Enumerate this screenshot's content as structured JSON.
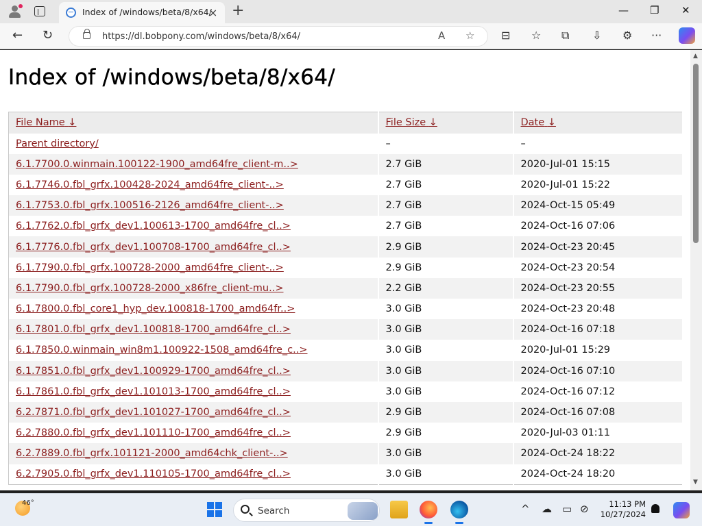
{
  "browser": {
    "tab": {
      "title": "Index of /windows/beta/8/x64/",
      "close_icon": "×"
    },
    "new_tab_icon": "+",
    "window_controls": {
      "minimize": "—",
      "maximize": "❐",
      "close": "✕"
    },
    "nav": {
      "back": "←",
      "refresh": "↻"
    },
    "address": {
      "url": "https://dl.bobpony.com/windows/beta/8/x64/",
      "read_aloud": "A",
      "favorite": "☆"
    },
    "toolbar_icons": {
      "split": "⊟",
      "favorites": "☆",
      "collections": "⧉",
      "downloads": "⇩",
      "extensions": "⚙",
      "more": "···"
    }
  },
  "page": {
    "title": "Index of /windows/beta/8/x64/",
    "columns": [
      {
        "label": "File Name",
        "sort": "↓"
      },
      {
        "label": "File Size",
        "sort": "↓"
      },
      {
        "label": "Date",
        "sort": "↓"
      }
    ],
    "rows": [
      {
        "name": "Parent directory/",
        "size": "–",
        "date": "–"
      },
      {
        "name": "6.1.7700.0.winmain.100122-1900_amd64fre_client-m..>",
        "size": "2.7 GiB",
        "date": "2020-Jul-01 15:15"
      },
      {
        "name": "6.1.7746.0.fbl_grfx.100428-2024_amd64fre_client-..>",
        "size": "2.7 GiB",
        "date": "2020-Jul-01 15:22"
      },
      {
        "name": "6.1.7753.0.fbl_grfx.100516-2126_amd64fre_client-..>",
        "size": "2.7 GiB",
        "date": "2024-Oct-15 05:49"
      },
      {
        "name": "6.1.7762.0.fbl_grfx_dev1.100613-1700_amd64fre_cl..>",
        "size": "2.7 GiB",
        "date": "2024-Oct-16 07:06"
      },
      {
        "name": "6.1.7776.0.fbl_grfx_dev1.100708-1700_amd64fre_cl..>",
        "size": "2.9 GiB",
        "date": "2024-Oct-23 20:45"
      },
      {
        "name": "6.1.7790.0.fbl_grfx.100728-2000_amd64fre_client-..>",
        "size": "2.9 GiB",
        "date": "2024-Oct-23 20:54"
      },
      {
        "name": "6.1.7790.0.fbl_grfx.100728-2000_x86fre_client-mu..>",
        "size": "2.2 GiB",
        "date": "2024-Oct-23 20:55"
      },
      {
        "name": "6.1.7800.0.fbl_core1_hyp_dev.100818-1700_amd64fr..>",
        "size": "3.0 GiB",
        "date": "2024-Oct-23 20:48"
      },
      {
        "name": "6.1.7801.0.fbl_grfx_dev1.100818-1700_amd64fre_cl..>",
        "size": "3.0 GiB",
        "date": "2024-Oct-16 07:18"
      },
      {
        "name": "6.1.7850.0.winmain_win8m1.100922-1508_amd64fre_c..>",
        "size": "3.0 GiB",
        "date": "2020-Jul-01 15:29"
      },
      {
        "name": "6.1.7851.0.fbl_grfx_dev1.100929-1700_amd64fre_cl..>",
        "size": "3.0 GiB",
        "date": "2024-Oct-16 07:10"
      },
      {
        "name": "6.1.7861.0.fbl_grfx_dev1.101013-1700_amd64fre_cl..>",
        "size": "3.0 GiB",
        "date": "2024-Oct-16 07:12"
      },
      {
        "name": "6.2.7871.0.fbl_grfx_dev1.101027-1700_amd64fre_cl..>",
        "size": "2.9 GiB",
        "date": "2024-Oct-16 07:08"
      },
      {
        "name": "6.2.7880.0.fbl_grfx_dev1.101110-1700_amd64fre_cl..>",
        "size": "2.9 GiB",
        "date": "2020-Jul-03 01:11"
      },
      {
        "name": "6.2.7889.0.fbl_grfx.101121-2000_amd64chk_client-..>",
        "size": "3.0 GiB",
        "date": "2024-Oct-24 18:22"
      },
      {
        "name": "6.2.7905.0.fbl_grfx_dev1.110105-1700_amd64fre_cl..>",
        "size": "3.0 GiB",
        "date": "2024-Oct-24 18:20"
      }
    ]
  },
  "taskbar": {
    "weather": {
      "temp": "46°"
    },
    "search": {
      "label": "Search"
    },
    "tray": {
      "chevron": "^",
      "clock_time": "11:13 PM",
      "clock_date": "10/27/2024"
    }
  },
  "colors": {
    "link": "#8b1d1d",
    "row_alt": "#f2f2f2",
    "header_bg": "#ececec",
    "accent": "#1a73e8"
  }
}
